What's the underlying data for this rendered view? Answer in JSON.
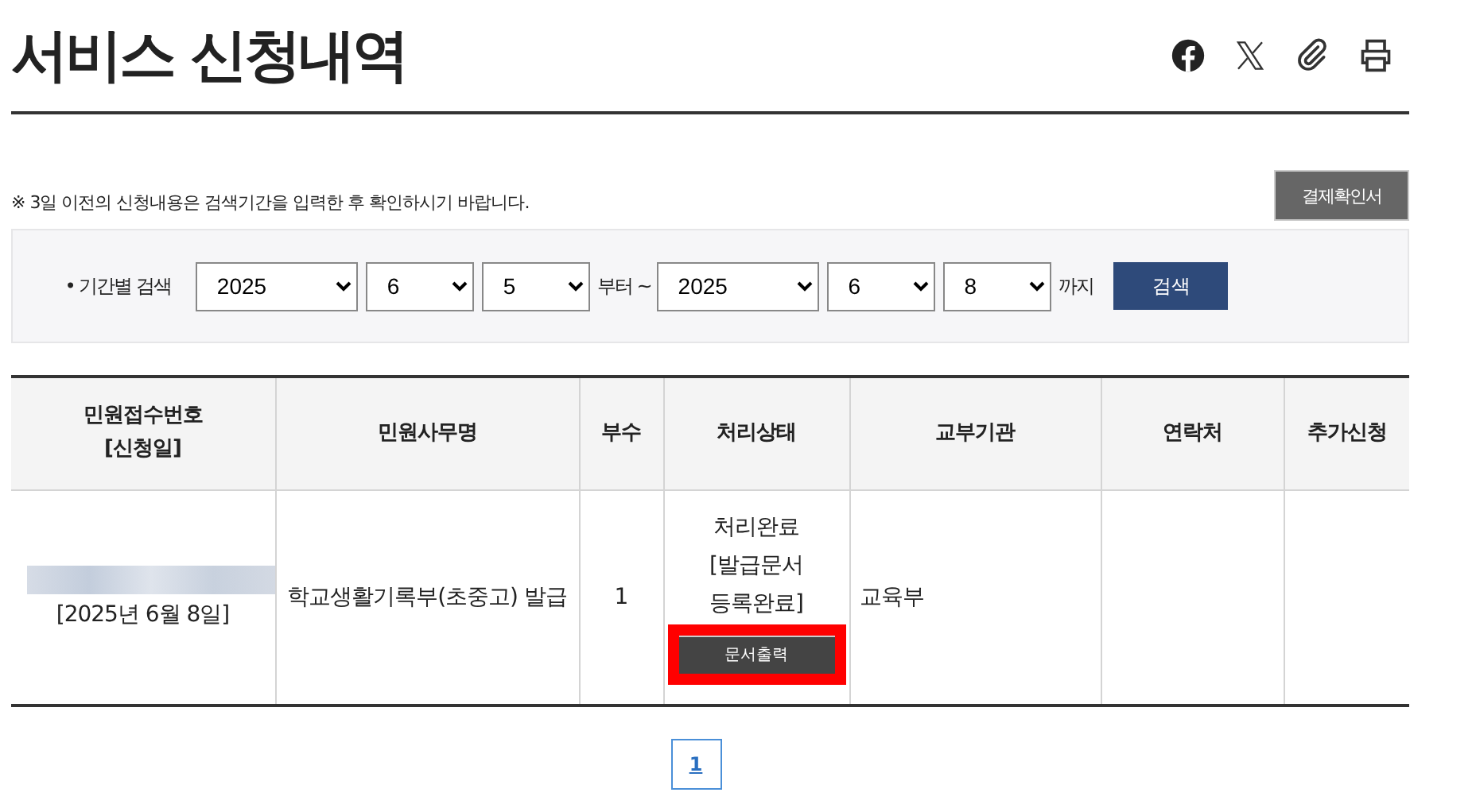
{
  "title": "서비스 신청내역",
  "share_icons": [
    {
      "kind": "facebook"
    },
    {
      "kind": "x"
    },
    {
      "kind": "link"
    },
    {
      "kind": "print"
    }
  ],
  "notice": "※ 3일 이전의 신청내용은 검색기간을 입력한 후 확인하시기 바랍니다.",
  "receipt_button": "결제확인서",
  "search": {
    "label": "• 기간별 검색",
    "from": [
      "2025",
      "6",
      "5"
    ],
    "from_suffix": "부터 ~",
    "to": [
      "2025",
      "6",
      "8"
    ],
    "to_suffix": "까지",
    "button": "검색"
  },
  "table": {
    "columns": [
      "민원접수번호\n[신청일]",
      "민원사무명",
      "부수",
      "처리상태",
      "교부기관",
      "연락처",
      "추가신청"
    ],
    "rows": [
      {
        "receipt_redacted": true,
        "date": "[2025년 6월 8일]",
        "service": "학교생활기록부(초중고) 발급",
        "copies": "1",
        "status": "처리완료\n[발급문서\n등록완료]",
        "action": {
          "label": "문서출력",
          "highlighted": true
        },
        "agency": "교육부",
        "contact": "",
        "extra": ""
      }
    ]
  },
  "pages": [
    {
      "label": "1",
      "selected": true
    }
  ]
}
